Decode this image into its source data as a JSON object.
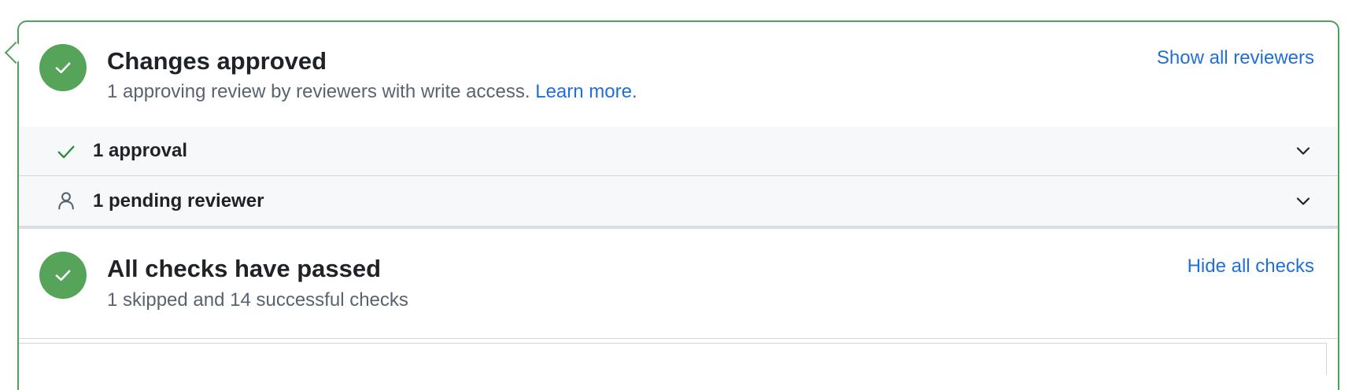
{
  "approvals": {
    "title": "Changes approved",
    "description": "1 approving review by reviewers with write access.",
    "learn_more": "Learn more.",
    "show_reviewers": "Show all reviewers",
    "icon": "check-circle-icon",
    "status_color": "#56a35a"
  },
  "reviews": [
    {
      "label": "1 approval",
      "icon": "check-icon"
    },
    {
      "label": "1 pending reviewer",
      "icon": "person-icon"
    }
  ],
  "checks": {
    "title": "All checks have passed",
    "description": "1 skipped and 14 successful checks",
    "hide_checks": "Hide all checks",
    "icon": "check-circle-icon",
    "status_color": "#56a35a"
  },
  "colors": {
    "border": "#4ea05a",
    "link": "#1f6fd6",
    "row_background": "#f6f8fa"
  }
}
